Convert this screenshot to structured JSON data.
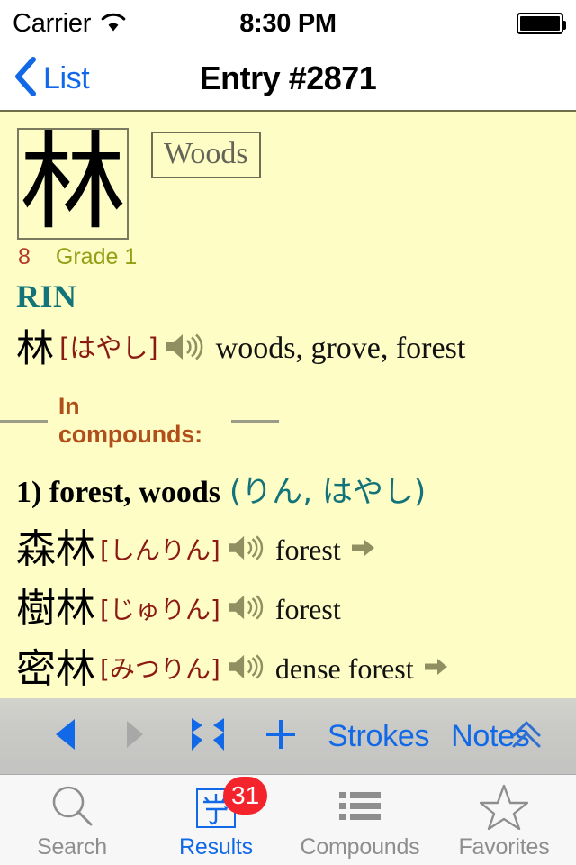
{
  "status_bar": {
    "carrier": "Carrier",
    "wifi_icon": "wifi-icon",
    "time": "8:30 PM",
    "battery_icon": "battery-icon"
  },
  "nav_bar": {
    "back_icon": "chevron-left-icon",
    "back_label": "List",
    "title": "Entry #2871"
  },
  "entry": {
    "kanji": "林",
    "meaning_tag": "Woods",
    "stroke_count": "8",
    "grade": "Grade 1",
    "on_reading": "RIN",
    "headword": {
      "kanji": "林",
      "kana": "[はやし]",
      "speaker_icon": "speaker-icon",
      "gloss": "woods, grove, forest"
    },
    "compounds_header": "In compounds:",
    "senses": [
      {
        "number_and_gloss": "1) forest, woods",
        "kana": "(りん, はやし)",
        "items": [
          {
            "kanji": "森林",
            "kana": "[しんりん]",
            "speaker_icon": "speaker-icon",
            "gloss": "forest",
            "has_arrow": true,
            "arrow_icon": "arrow-right-icon"
          },
          {
            "kanji": "樹林",
            "kana": "[じゅりん]",
            "speaker_icon": "speaker-icon",
            "gloss": "forest",
            "has_arrow": false,
            "arrow_icon": ""
          },
          {
            "kanji": "密林",
            "kana": "[みつりん]",
            "speaker_icon": "speaker-icon",
            "gloss": "dense forest",
            "has_arrow": true,
            "arrow_icon": "arrow-right-icon"
          }
        ]
      }
    ]
  },
  "toolbar": {
    "prev_icon": "triangle-left-icon",
    "next_icon": "triangle-right-icon",
    "compare_icon": "double-chevron-inward-icon",
    "add_icon": "plus-icon",
    "strokes_label": "Strokes",
    "notes_label": "Notes",
    "collapse_icon": "double-chevron-up-icon"
  },
  "tab_bar": {
    "tabs": [
      {
        "label": "Search",
        "icon": "magnifier-icon",
        "selected": false,
        "badge": ""
      },
      {
        "label": "Results",
        "icon": "kanji-strokes-icon",
        "selected": true,
        "badge": "31"
      },
      {
        "label": "Compounds",
        "icon": "list-icon",
        "selected": false,
        "badge": ""
      },
      {
        "label": "Favorites",
        "icon": "star-icon",
        "selected": false,
        "badge": ""
      }
    ]
  },
  "colors": {
    "page_background": "#fdfdc5",
    "accent_blue": "#1269e8",
    "reading_teal": "#12737a",
    "kana_red": "#8b1a12",
    "stroke_red": "#b4392b",
    "grade_olive": "#93a015",
    "compounds_orange": "#b14f1b",
    "speaker_olive": "#8f8f62",
    "badge_red": "#f4242c"
  }
}
